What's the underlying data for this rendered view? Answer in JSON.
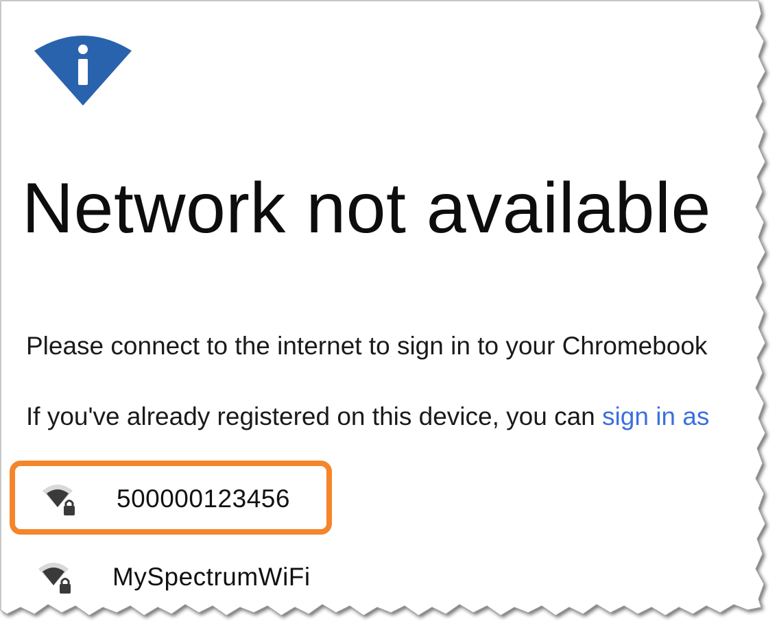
{
  "header": {
    "icon": "network-info-icon",
    "title": "Network not available"
  },
  "message": {
    "line1": "Please connect to the internet to sign in to your Chromebook",
    "line2_prefix": "If you've already registered on this device, you can ",
    "line2_link": "sign in as"
  },
  "networks": [
    {
      "name": "500000123456",
      "icon": "wifi-locked-icon",
      "highlighted": true
    },
    {
      "name": "MySpectrumWiFi",
      "icon": "wifi-locked-icon",
      "highlighted": false
    }
  ],
  "colors": {
    "accent_blue": "#2a63ad",
    "link_blue": "#3b6fe0",
    "highlight_orange": "#f5852a",
    "text": "#111111"
  }
}
